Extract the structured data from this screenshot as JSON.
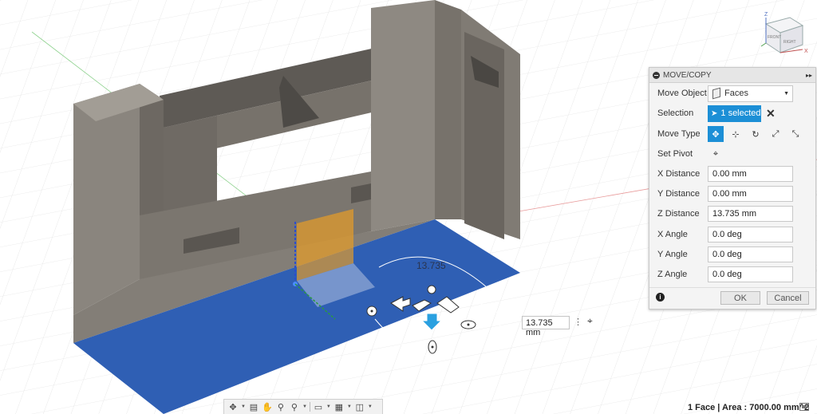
{
  "panel": {
    "title": "MOVE/COPY",
    "expand_label": "▸▸",
    "move_object_label": "Move Object",
    "move_object_value": "Faces",
    "selection_label": "Selection",
    "selection_value": "1 selected",
    "move_type_label": "Move Type",
    "set_pivot_label": "Set Pivot",
    "fields": [
      {
        "label": "X Distance",
        "value": "0.00 mm"
      },
      {
        "label": "Y Distance",
        "value": "0.00 mm"
      },
      {
        "label": "Z Distance",
        "value": "13.735 mm"
      },
      {
        "label": "X Angle",
        "value": "0.0 deg"
      },
      {
        "label": "Y Angle",
        "value": "0.0 deg"
      },
      {
        "label": "Z Angle",
        "value": "0.0 deg"
      }
    ],
    "ok_label": "OK",
    "cancel_label": "Cancel",
    "accent": "#1c8fd6"
  },
  "viewport": {
    "manipulator_value": "13.735",
    "distance_input_value": "13.735 mm",
    "selected_face_color": "#2f5fb4",
    "body_color": "#7c7770",
    "preview_color": "#f0a020",
    "viewcube": {
      "front": "FRONT",
      "right": "RIGHT",
      "axis_z": "Z",
      "axis_x": "X"
    }
  },
  "status_bar": {
    "text": "1 Face | Area : 7000.00 mm^2"
  },
  "toolbar_icons": [
    "orbit-icon",
    "look-at-icon",
    "pan-icon",
    "zoom-window-icon",
    "zoom-icon",
    "display-settings-icon",
    "grid-icon",
    "viewports-icon"
  ]
}
